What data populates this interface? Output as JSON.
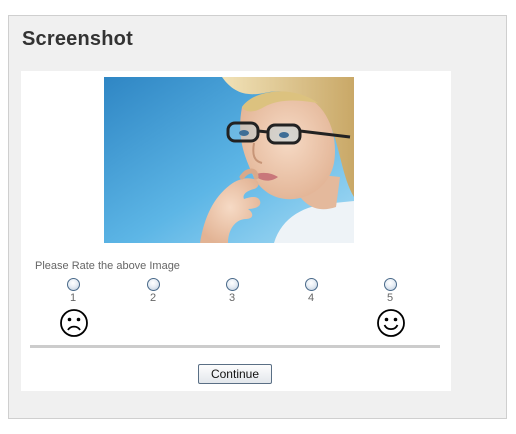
{
  "panel": {
    "title": "Screenshot"
  },
  "photo": {
    "alt_icon": "portrait-photo",
    "colors": {
      "background": "#4aa3d6",
      "skin": "#f1cdb3",
      "hair": "#e3c98a"
    }
  },
  "rating": {
    "prompt": "Please Rate the above Image",
    "options": [
      "1",
      "2",
      "3",
      "4",
      "5"
    ],
    "selected": null,
    "low_icon": "sad-face-icon",
    "high_icon": "happy-face-icon"
  },
  "actions": {
    "continue_label": "Continue"
  }
}
